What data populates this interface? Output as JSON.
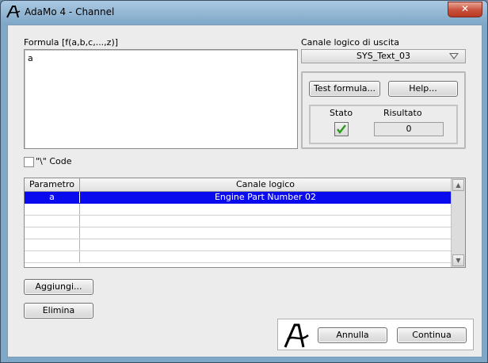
{
  "window": {
    "title": "AdaMo 4 - Channel",
    "close_label": "✕"
  },
  "formula": {
    "label": "Formula [f(a,b,c,...,z)]",
    "value": "a"
  },
  "output_channel": {
    "label": "Canale logico di uscita",
    "selected": "SYS_Text_03"
  },
  "buttons": {
    "test_formula": "Test formula...",
    "help": "Help...",
    "add": "Aggiungi...",
    "delete": "Elimina",
    "cancel": "Annulla",
    "continue": "Continua"
  },
  "status": {
    "stato_label": "Stato",
    "risultato_label": "Risultato",
    "risultato_value": "0"
  },
  "code_option": {
    "label": "\"\\\" Code",
    "checked": false
  },
  "table": {
    "columns": [
      "Parametro",
      "Canale logico"
    ],
    "rows": [
      {
        "parametro": "a",
        "canale": "Engine Part Number 02",
        "selected": true
      },
      {
        "parametro": "",
        "canale": "",
        "selected": false
      },
      {
        "parametro": "",
        "canale": "",
        "selected": false
      },
      {
        "parametro": "",
        "canale": "",
        "selected": false
      },
      {
        "parametro": "",
        "canale": "",
        "selected": false
      },
      {
        "parametro": "",
        "canale": "",
        "selected": false
      }
    ]
  },
  "icons": {
    "app": "adamo-logo-icon",
    "stato_check": "green-checkmark-icon",
    "combo": "chevron-down-icon",
    "scroll_up": "scroll-up-arrow-icon",
    "scroll_down": "scroll-down-arrow-icon",
    "footer_logo": "adamo-logo-icon"
  },
  "colors": {
    "selection": "#0a0aee",
    "check_green": "#2e9b1f",
    "close_button": "#c8503a"
  }
}
